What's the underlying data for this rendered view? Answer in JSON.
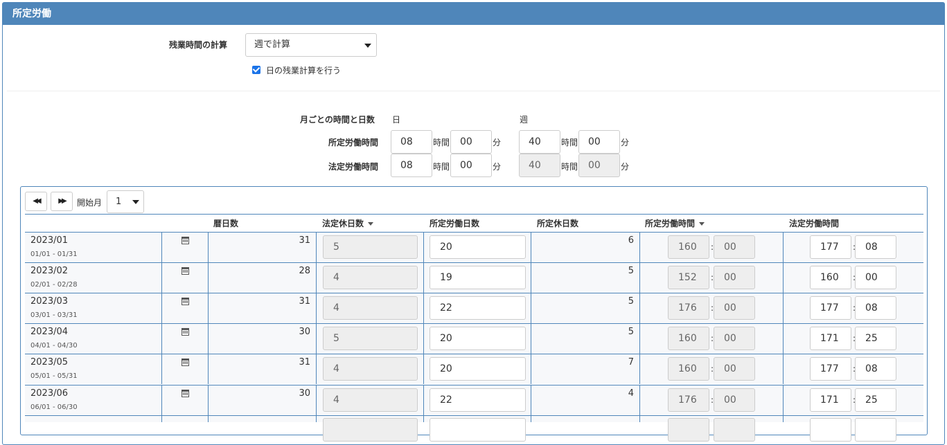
{
  "panel": {
    "title": "所定労働"
  },
  "overtime": {
    "label": "残業時間の計算",
    "select_value": "週で計算",
    "daily_checkbox_label": "日の残業計算を行う",
    "daily_checked": true
  },
  "monthly": {
    "label": "月ごとの時間と日数",
    "day_header": "日",
    "week_header": "週",
    "rows": [
      {
        "label": "所定労働時間",
        "day_h": "08",
        "day_m": "00",
        "week_h": "40",
        "week_m": "00"
      },
      {
        "label": "法定労働時間",
        "day_h": "08",
        "day_m": "00",
        "week_h": "40",
        "week_m": "00"
      }
    ],
    "unit_hour": "時間",
    "unit_min": "分"
  },
  "table": {
    "prev_icon": "double-left-arrow",
    "next_icon": "double-right-arrow",
    "start_month_label": "開始月",
    "start_month_value": "1",
    "headers": {
      "calendar_days": "暦日数",
      "legal_holidays": "法定休日数",
      "work_days": "所定労働日数",
      "scheduled_holidays": "所定休日数",
      "work_hours": "所定労働時間",
      "legal_hours": "法定労働時間"
    },
    "rows": [
      {
        "month": "2023/01",
        "range": "01/01 - 01/31",
        "cal": "31",
        "legal_hol": "5",
        "work_days": "20",
        "sched_hol": "6",
        "wh_h": "160",
        "wh_m": "00",
        "lh_h": "177",
        "lh_m": "08"
      },
      {
        "month": "2023/02",
        "range": "02/01 - 02/28",
        "cal": "28",
        "legal_hol": "4",
        "work_days": "19",
        "sched_hol": "5",
        "wh_h": "152",
        "wh_m": "00",
        "lh_h": "160",
        "lh_m": "00"
      },
      {
        "month": "2023/03",
        "range": "03/01 - 03/31",
        "cal": "31",
        "legal_hol": "4",
        "work_days": "22",
        "sched_hol": "5",
        "wh_h": "176",
        "wh_m": "00",
        "lh_h": "177",
        "lh_m": "08"
      },
      {
        "month": "2023/04",
        "range": "04/01 - 04/30",
        "cal": "30",
        "legal_hol": "5",
        "work_days": "20",
        "sched_hol": "5",
        "wh_h": "160",
        "wh_m": "00",
        "lh_h": "171",
        "lh_m": "25"
      },
      {
        "month": "2023/05",
        "range": "05/01 - 05/31",
        "cal": "31",
        "legal_hol": "4",
        "work_days": "20",
        "sched_hol": "7",
        "wh_h": "160",
        "wh_m": "00",
        "lh_h": "177",
        "lh_m": "08"
      },
      {
        "month": "2023/06",
        "range": "06/01 - 06/30",
        "cal": "30",
        "legal_hol": "4",
        "work_days": "22",
        "sched_hol": "4",
        "wh_h": "176",
        "wh_m": "00",
        "lh_h": "171",
        "lh_m": "25"
      }
    ]
  }
}
